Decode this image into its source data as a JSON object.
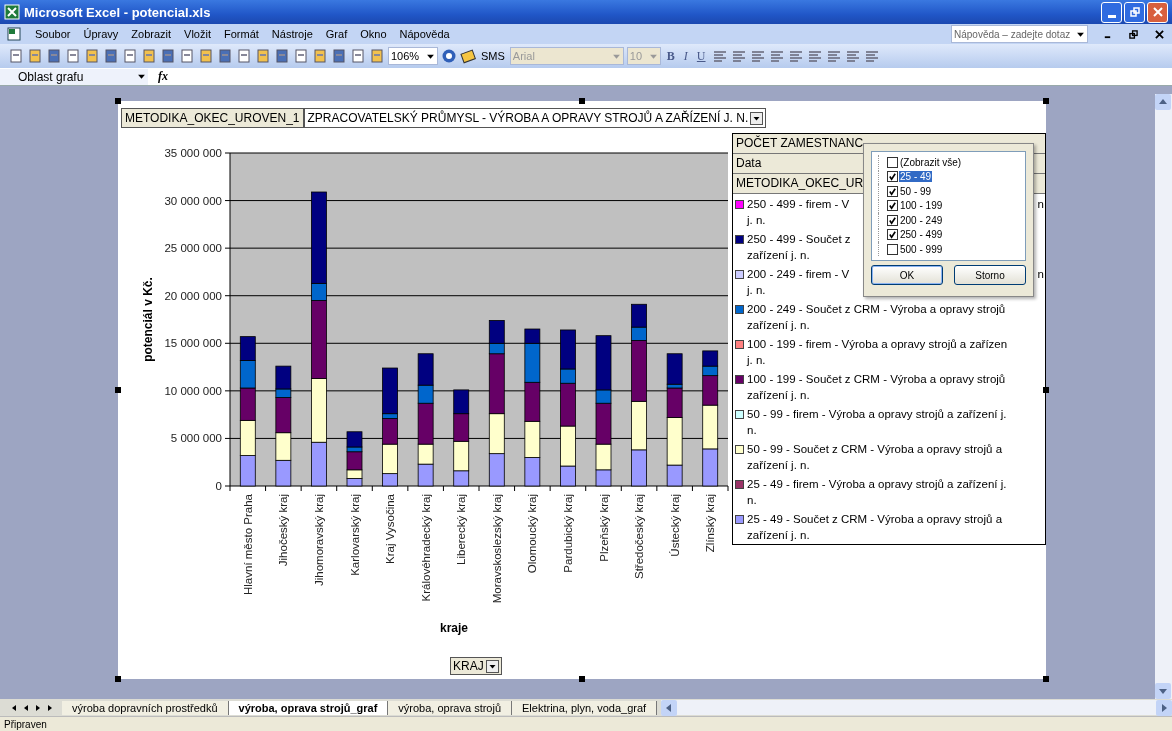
{
  "window": {
    "title": "Microsoft Excel - potencial.xls"
  },
  "menu": [
    "Soubor",
    "Úpravy",
    "Zobrazit",
    "Vložit",
    "Formát",
    "Nástroje",
    "Graf",
    "Okno",
    "Nápověda"
  ],
  "help_search": {
    "placeholder": "Nápověda – zadejte dotaz"
  },
  "toolbar": {
    "zoom": "106%",
    "sms": "SMS",
    "font": "Arial",
    "font_size": "10",
    "bold": "B",
    "italic": "I",
    "underline": "U"
  },
  "name_box": "Oblast grafu",
  "formula_icon": "fx",
  "pivot": {
    "field": "METODIKA_OKEC_UROVEN_1",
    "value": "ZPRACOVATELSKÝ PRŮMYSL - VÝROBA A OPRAVY STROJŮ A ZAŘÍZENÍ J. N.",
    "row_field": "KRAJ"
  },
  "legend_fields": [
    "POČET ZAMESTNANC",
    "Data",
    "METODIKA_OKEC_UR"
  ],
  "legend": [
    {
      "continuation": "j. n.",
      "tail": "n"
    },
    {
      "continuation": "zařízení j. n."
    },
    {
      "continuation": "j. n.",
      "tail": "n"
    },
    {
      "continuation": "zařízení j. n."
    },
    {
      "continuation": "j. n."
    },
    {
      "continuation": "zařízení j. n."
    },
    {
      "continuation": "n."
    },
    {
      "continuation": "zařízení j. n."
    },
    {
      "continuation": "n."
    },
    {
      "continuation": "zařízení j. n."
    }
  ],
  "chart_data": {
    "type": "bar",
    "stacked": true,
    "orientation": "vertical",
    "grid": true,
    "xlabel": "kraje",
    "ylabel": "potenciál v Kč.",
    "categories": [
      "Hlavní město Praha",
      "Jihočeský kraj",
      "Jihomoravský kraj",
      "Karlovarský kraj",
      "Kraj Vysočina",
      "Královéhradecký kraj",
      "Liberecký kraj",
      "Moravskoslezský kraj",
      "Olomoucký kraj",
      "Pardubický kraj",
      "Plzeňský kraj",
      "Středočeský kraj",
      "Ústecký kraj",
      "Zlínský kraj"
    ],
    "ylim": [
      0,
      35000000
    ],
    "yticks": [
      {
        "value": 0,
        "label": "0"
      },
      {
        "value": 5000000,
        "label": "5 000 000"
      },
      {
        "value": 10000000,
        "label": "10 000 000"
      },
      {
        "value": 15000000,
        "label": "15 000 000"
      },
      {
        "value": 20000000,
        "label": "20 000 000"
      },
      {
        "value": 25000000,
        "label": "25 000 000"
      },
      {
        "value": 30000000,
        "label": "30 000 000"
      },
      {
        "value": 35000000,
        "label": "35 000 000"
      }
    ],
    "series": [
      {
        "name": "250 - 499 - firem - V",
        "color": "#ff00ff",
        "values": [
          0,
          0,
          0,
          0,
          0,
          0,
          0,
          0,
          0,
          0,
          0,
          0,
          0,
          0
        ]
      },
      {
        "name": "250 - 499 - Součet z",
        "color": "#000080",
        "values": [
          2500000,
          2400000,
          9600000,
          1600000,
          4800000,
          3300000,
          2500000,
          2400000,
          1500000,
          4100000,
          5700000,
          2400000,
          3200000,
          1600000
        ]
      },
      {
        "name": "200 - 249 - firem - V",
        "color": "#ccccff",
        "values": [
          0,
          0,
          0,
          0,
          0,
          0,
          0,
          0,
          0,
          0,
          0,
          0,
          0,
          0
        ]
      },
      {
        "name": "200 - 249 - Součet z CRM - Výroba a opravy strojů",
        "color": "#0066cc",
        "values": [
          2900000,
          900000,
          1800000,
          500000,
          500000,
          1900000,
          0,
          1100000,
          4100000,
          1500000,
          1400000,
          1400000,
          400000,
          1000000
        ]
      },
      {
        "name": "100 - 199 - firem - Výroba a opravy strojů a zařízen",
        "color": "#ff8080",
        "values": [
          0,
          0,
          0,
          0,
          0,
          0,
          0,
          0,
          0,
          0,
          0,
          0,
          0,
          0
        ]
      },
      {
        "name": "100 - 199 - Součet z CRM - Výroba a opravy strojů",
        "color": "#660066",
        "values": [
          3400000,
          3700000,
          8200000,
          1900000,
          2700000,
          4300000,
          2900000,
          6300000,
          4100000,
          4500000,
          4300000,
          6400000,
          3100000,
          3100000
        ]
      },
      {
        "name": "50 - 99 - firem - Výroba a opravy strojů a zařízení j.",
        "color": "#ccffff",
        "values": [
          0,
          0,
          0,
          0,
          0,
          0,
          0,
          0,
          0,
          0,
          0,
          0,
          0,
          0
        ]
      },
      {
        "name": "50 - 99 - Součet z CRM - Výroba a opravy strojů a",
        "color": "#ffffcc",
        "values": [
          3700000,
          2900000,
          6700000,
          900000,
          3100000,
          2100000,
          3100000,
          4200000,
          3800000,
          4200000,
          2700000,
          5100000,
          5000000,
          4600000
        ]
      },
      {
        "name": "25 - 49 - firem - Výroba a opravy strojů a zařízení j.",
        "color": "#993366",
        "values": [
          0,
          0,
          0,
          0,
          0,
          0,
          0,
          0,
          0,
          0,
          0,
          0,
          0,
          0
        ]
      },
      {
        "name": "25 - 49 - Součet z CRM - Výroba a opravy strojů a",
        "color": "#9999ff",
        "values": [
          3200000,
          2700000,
          4600000,
          800000,
          1300000,
          2300000,
          1600000,
          3400000,
          3000000,
          2100000,
          1700000,
          3800000,
          2200000,
          3900000
        ]
      }
    ]
  },
  "filter_popup": {
    "items": [
      {
        "label": "(Zobrazit vše)",
        "checked": false,
        "selected": false
      },
      {
        "label": "25 - 49",
        "checked": true,
        "selected": true
      },
      {
        "label": "50 - 99",
        "checked": true,
        "selected": false
      },
      {
        "label": "100 - 199",
        "checked": true,
        "selected": false
      },
      {
        "label": "200 - 249",
        "checked": true,
        "selected": false
      },
      {
        "label": "250 - 499",
        "checked": true,
        "selected": false
      },
      {
        "label": "500 - 999",
        "checked": false,
        "selected": false
      }
    ],
    "buttons": [
      "OK",
      "Storno"
    ]
  },
  "sheet_tabs": [
    {
      "label": "výroba dopravních prostředků",
      "selected": false
    },
    {
      "label": "výroba, oprava strojů_graf",
      "selected": true
    },
    {
      "label": "výroba, oprava strojů",
      "selected": false
    },
    {
      "label": "Elektrina, plyn, voda_graf",
      "selected": false
    }
  ],
  "status_bar": "Připraven"
}
